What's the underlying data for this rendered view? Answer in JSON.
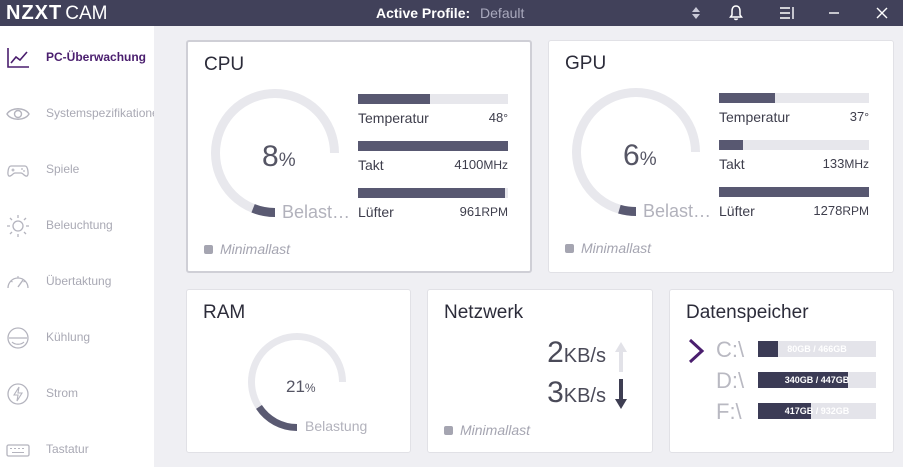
{
  "app": {
    "logo_main": "NZXT",
    "logo_sub": "CAM"
  },
  "titlebar": {
    "profile_label": "Active Profile:",
    "profile_value": "Default",
    "icons": [
      "sort-icon",
      "bell-icon",
      "menu-icon",
      "minimize-icon",
      "close-icon"
    ]
  },
  "sidebar": {
    "items": [
      {
        "label": "PC-Überwachung",
        "icon": "line-chart-icon",
        "active": true
      },
      {
        "label": "Systemspezifikationen",
        "icon": "eye-icon",
        "active": false
      },
      {
        "label": "Spiele",
        "icon": "gamepad-icon",
        "active": false
      },
      {
        "label": "Beleuchtung",
        "icon": "sun-icon",
        "active": false
      },
      {
        "label": "Übertaktung",
        "icon": "speedometer-icon",
        "active": false
      },
      {
        "label": "Kühlung",
        "icon": "cooling-icon",
        "active": false
      },
      {
        "label": "Strom",
        "icon": "bolt-icon",
        "active": false
      },
      {
        "label": "Tastatur",
        "icon": "keyboard-icon",
        "active": false
      }
    ]
  },
  "cpu": {
    "title": "CPU",
    "load_value": "8",
    "load_unit": "%",
    "load_fraction": 0.08,
    "load_caption": "Belast…",
    "status": "Minimallast",
    "metrics": [
      {
        "label": "Temperatur",
        "value": "48",
        "unit": "°",
        "fill": 0.48
      },
      {
        "label": "Takt",
        "value": "4100",
        "unit": "MHz",
        "fill": 1.0
      },
      {
        "label": "Lüfter",
        "value": "961",
        "unit": "RPM",
        "fill": 0.98
      }
    ]
  },
  "gpu": {
    "title": "GPU",
    "load_value": "6",
    "load_unit": "%",
    "load_fraction": 0.06,
    "load_caption": "Belast…",
    "status": "Minimallast",
    "metrics": [
      {
        "label": "Temperatur",
        "value": "37",
        "unit": "°",
        "fill": 0.37
      },
      {
        "label": "Takt",
        "value": "133",
        "unit": "MHz",
        "fill": 0.16
      },
      {
        "label": "Lüfter",
        "value": "1278",
        "unit": "RPM",
        "fill": 1.0
      }
    ]
  },
  "ram": {
    "title": "RAM",
    "load_value": "21",
    "load_unit": "%",
    "load_fraction": 0.21,
    "load_caption": "Belastung"
  },
  "network": {
    "title": "Netzwerk",
    "upload_value": "2",
    "upload_unit": "KB/s",
    "download_value": "3",
    "download_unit": "KB/s",
    "status": "Minimallast"
  },
  "storage": {
    "title": "Datenspeicher",
    "drives": [
      {
        "letter": "C:\\",
        "usage": "80GB / 466GB",
        "fraction": 0.17,
        "selected": true
      },
      {
        "letter": "D:\\",
        "usage": "340GB / 447GB",
        "fraction": 0.76,
        "selected": false
      },
      {
        "letter": "F:\\",
        "usage": "417GB / 932GB",
        "fraction": 0.45,
        "selected": false
      }
    ]
  },
  "colors": {
    "titlebar": "#41415a",
    "accent": "#4a1e6e",
    "gauge_track": "#e8e8ed",
    "gauge_fill": "#5a5a72"
  }
}
